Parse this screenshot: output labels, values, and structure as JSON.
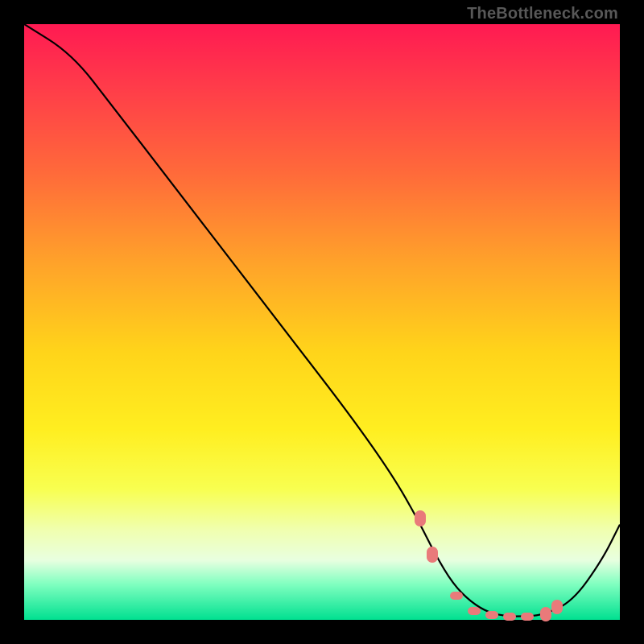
{
  "watermark": "TheBottleneck.com",
  "chart_data": {
    "type": "line",
    "title": "",
    "xlabel": "",
    "ylabel": "",
    "xlim": [
      0,
      100
    ],
    "ylim": [
      0,
      100
    ],
    "series": [
      {
        "name": "bottleneck-curve",
        "x": [
          0,
          8,
          15,
          25,
          35,
          45,
          55,
          62,
          66,
          69,
          72,
          75,
          78,
          81,
          84,
          87,
          92,
          97,
          100
        ],
        "y": [
          100,
          95,
          86,
          73,
          60,
          47,
          34,
          24,
          17,
          11,
          6,
          3,
          1.2,
          0.6,
          0.6,
          0.8,
          3,
          10,
          16
        ]
      }
    ],
    "markers": {
      "name": "highlight-points",
      "x": [
        66.5,
        68.5,
        72.5,
        75.5,
        78.5,
        81.5,
        84.5,
        87.5,
        89.5
      ],
      "y": [
        17,
        11,
        4,
        1.5,
        0.8,
        0.6,
        0.6,
        0.9,
        2.2
      ],
      "color": "#e97a7a"
    },
    "gradient": {
      "top": "#ff1a52",
      "bottom": "#00e090",
      "stops": [
        "red",
        "orange",
        "yellow",
        "green"
      ]
    }
  }
}
